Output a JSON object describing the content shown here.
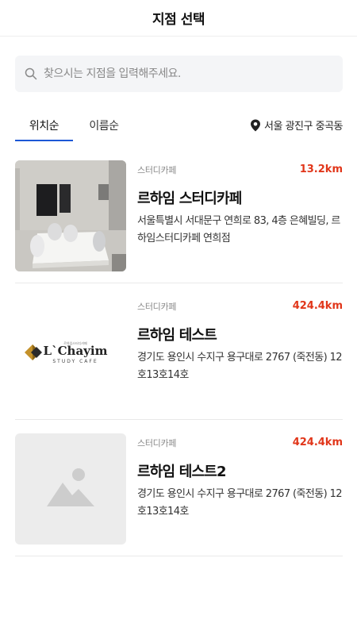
{
  "header": {
    "title": "지점 선택"
  },
  "search": {
    "placeholder": "찾으시는 지점을 입력해주세요.",
    "icon": "search-icon"
  },
  "tabs": [
    {
      "label": "위치순",
      "active": true
    },
    {
      "label": "이름순",
      "active": false
    }
  ],
  "location_filter": {
    "label": "서울 광진구 중곡동",
    "icon": "location-pin-icon"
  },
  "colors": {
    "accent": "#1c57d6",
    "distance": "#e1361a"
  },
  "branches": [
    {
      "category": "스터디카페",
      "distance": "13.2km",
      "name": "르하임 스터디카페",
      "address": "서울특별시 서대문구 연희로 83, 4층 은혜빌딩, 르하임스터디카페 연희점",
      "thumbnail": "room-photo"
    },
    {
      "category": "스터디카페",
      "distance": "424.4km",
      "name": "르하임 테스트",
      "address": "경기도 용인시 수지구 용구대로 2767 (죽전동) 12호13호14호",
      "thumbnail": "brand-logo",
      "logo": {
        "small_text": "르하임스터디카페",
        "main_text": "L`Chayim",
        "sub_text": "STUDY CAFE"
      }
    },
    {
      "category": "스터디카페",
      "distance": "424.4km",
      "name": "르하임 테스트2",
      "address": "경기도 용인시 수지구 용구대로 2767 (죽전동) 12호13호14호",
      "thumbnail": "image-placeholder-icon"
    }
  ]
}
